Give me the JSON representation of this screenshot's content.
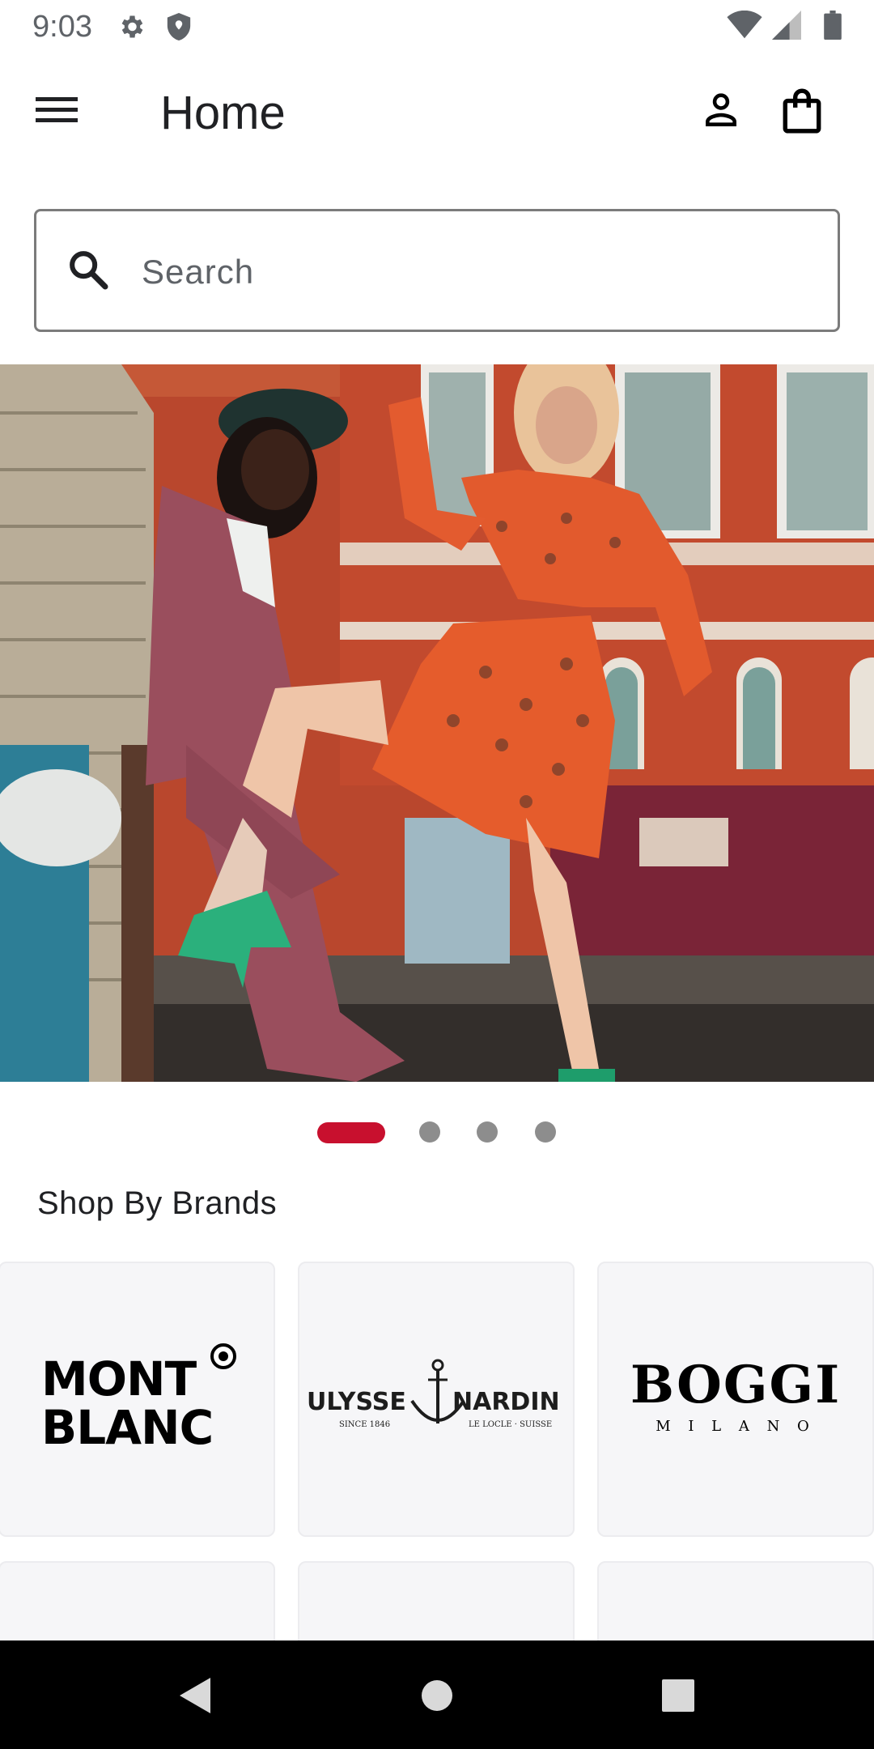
{
  "status_bar": {
    "time": "9:03",
    "icons": [
      "gear-icon",
      "shield-icon",
      "wifi-icon",
      "signal-icon",
      "battery-icon"
    ]
  },
  "app_bar": {
    "title": "Home",
    "icons": [
      "menu-icon",
      "person-icon",
      "shopping-bag-icon"
    ]
  },
  "search": {
    "placeholder": "Search",
    "value": ""
  },
  "carousel": {
    "slide_count": 4,
    "active_index": 0,
    "accent_color": "#c8102e"
  },
  "brands_section": {
    "title": "Shop By Brands",
    "brands": [
      {
        "line1": "MONT",
        "line2": "BLANC"
      },
      {
        "name_left": "ULYSSE",
        "name_right": "NARDIN",
        "tagline_left": "SINCE 1846",
        "tagline_right": "LE LOCLE · SUISSE"
      },
      {
        "name": "BOGGI",
        "subtitle": "M I L A N O"
      }
    ]
  },
  "nav_bar": {
    "icons": [
      "back-icon",
      "home-icon",
      "recents-icon"
    ]
  }
}
